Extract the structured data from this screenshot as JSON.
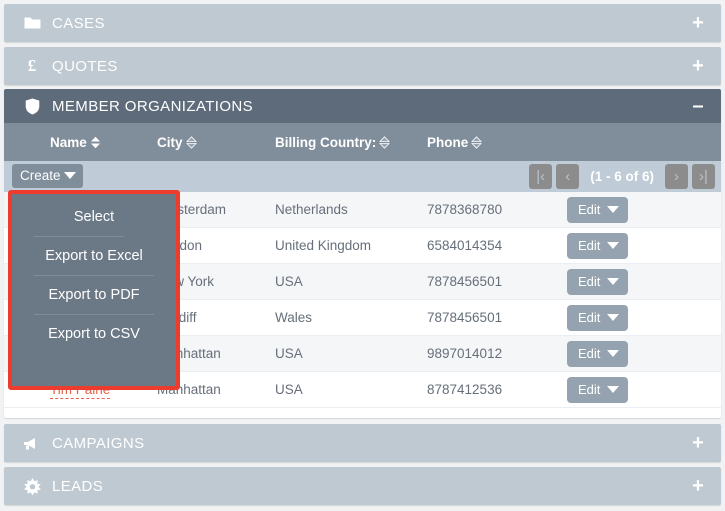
{
  "colors": {
    "panel_collapsed_bg": "#bfc9d2",
    "panel_open_header_bg": "#5d6b7a",
    "table_header_bg": "#808d9b",
    "toolbar_bg": "#bfcbd6",
    "dropdown_bg": "#6b7886",
    "highlight_border": "#ec3c2d",
    "link_color": "#e5604a",
    "edit_button_bg": "#95a3b0"
  },
  "panels": [
    {
      "id": "cases",
      "title": "CASES",
      "icon": "folder-icon",
      "toggle": "+",
      "state": "collapsed"
    },
    {
      "id": "quotes",
      "title": "QUOTES",
      "icon": "pound-icon",
      "toggle": "+",
      "state": "collapsed"
    },
    {
      "id": "member_orgs",
      "title": "MEMBER ORGANIZATIONS",
      "icon": "shield-icon",
      "toggle": "–",
      "state": "expanded"
    },
    {
      "id": "campaigns",
      "title": "CAMPAIGNS",
      "icon": "megaphone-icon",
      "toggle": "+",
      "state": "collapsed"
    },
    {
      "id": "leads",
      "title": "LEADS",
      "icon": "starburst-icon",
      "toggle": "+",
      "state": "collapsed"
    }
  ],
  "table": {
    "columns": [
      {
        "key": "name",
        "label": "Name",
        "sortable": true,
        "sort_active": true
      },
      {
        "key": "city",
        "label": "City",
        "sortable": true,
        "sort_active": false
      },
      {
        "key": "country",
        "label": "Billing Country:",
        "sortable": true,
        "sort_active": false
      },
      {
        "key": "phone",
        "label": "Phone",
        "sortable": true,
        "sort_active": false
      }
    ],
    "rows": [
      {
        "name": "",
        "city": "Amsterdam",
        "country": "Netherlands",
        "phone": "7878368780",
        "action": "Edit"
      },
      {
        "name": "",
        "city": "London",
        "country": "United Kingdom",
        "phone": "6584014354",
        "action": "Edit"
      },
      {
        "name": "",
        "city": "New York",
        "country": "USA",
        "phone": "7878456501",
        "action": "Edit"
      },
      {
        "name": "",
        "city": "Cardiff",
        "country": "Wales",
        "phone": "7878456501",
        "action": "Edit"
      },
      {
        "name": "",
        "city": "Manhattan",
        "country": "USA",
        "phone": "9897014012",
        "action": "Edit"
      },
      {
        "name": "Tim Paine",
        "city": "Manhattan",
        "country": "USA",
        "phone": "8787412536",
        "action": "Edit"
      }
    ]
  },
  "toolbar": {
    "create_label": "Create",
    "pager": {
      "first_label": "|‹",
      "prev_label": "‹",
      "count_label": "(1 - 6 of 6)",
      "next_label": "›",
      "last_label": "›|"
    }
  },
  "dropdown": {
    "items": [
      {
        "label": "Select"
      },
      {
        "label": "Export to Excel"
      },
      {
        "label": "Export to PDF"
      },
      {
        "label": "Export to CSV"
      }
    ]
  }
}
